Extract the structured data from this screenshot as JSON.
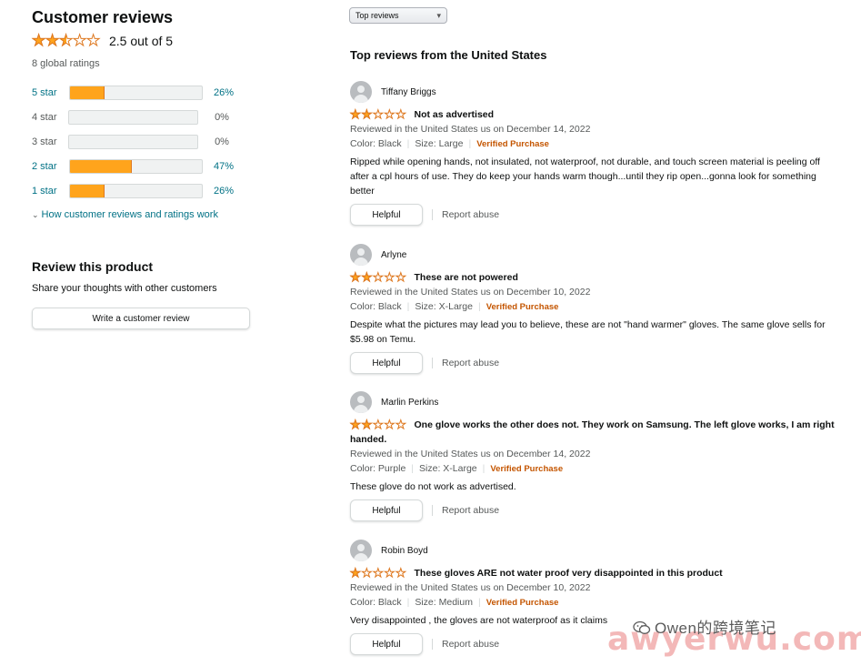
{
  "summary": {
    "title": "Customer reviews",
    "average_rating": 2.5,
    "average_text": "2.5 out of 5",
    "global_ratings": "8 global ratings",
    "histogram": [
      {
        "label": "5 star",
        "percent": 26,
        "percent_text": "26%"
      },
      {
        "label": "4 star",
        "percent": 0,
        "percent_text": "0%"
      },
      {
        "label": "3 star",
        "percent": 0,
        "percent_text": "0%"
      },
      {
        "label": "2 star",
        "percent": 47,
        "percent_text": "47%"
      },
      {
        "label": "1 star",
        "percent": 26,
        "percent_text": "26%"
      }
    ],
    "how_link": "How customer reviews and ratings work"
  },
  "review_product": {
    "title": "Review this product",
    "subtitle": "Share your thoughts with other customers",
    "button": "Write a customer review"
  },
  "sort": {
    "selected": "Top reviews"
  },
  "reviews_heading": "Top reviews from the United States",
  "reviews": [
    {
      "name": "Tiffany Briggs",
      "rating": 2,
      "title": "Not as advertised",
      "date": "Reviewed in the United States us on December 14, 2022",
      "color": "Color: Black",
      "size": "Size: Large",
      "verified": "Verified Purchase",
      "body": "Ripped while opening hands, not insulated, not waterproof, not durable, and touch screen material is peeling off after a cpl hours of use. They do keep your hands warm though...until they rip open...gonna look for something better",
      "helpful": "Helpful",
      "report": "Report abuse"
    },
    {
      "name": "Arlyne",
      "rating": 2,
      "title": "These are not powered",
      "date": "Reviewed in the United States us on December 10, 2022",
      "color": "Color: Black",
      "size": "Size: X-Large",
      "verified": "Verified Purchase",
      "body": "Despite what the pictures may lead you to believe, these are not \"hand warmer\" gloves. The same glove sells for $5.98 on Temu.",
      "helpful": "Helpful",
      "report": "Report abuse"
    },
    {
      "name": "Marlin Perkins",
      "rating": 2,
      "title": "One glove works the other does not. They work on Samsung. The left glove works, I am right handed.",
      "date": "Reviewed in the United States us on December 14, 2022",
      "color": "Color: Purple",
      "size": "Size: X-Large",
      "verified": "Verified Purchase",
      "body": "These glove do not work as advertised.",
      "helpful": "Helpful",
      "report": "Report abuse"
    },
    {
      "name": "Robin Boyd",
      "rating": 1,
      "title": "These gloves ARE not water proof very disappointed in this product",
      "date": "Reviewed in the United States us on December 10, 2022",
      "color": "Color: Black",
      "size": "Size: Medium",
      "verified": "Verified Purchase",
      "body": "Very disappointed , the gloves are not waterproof as it claims",
      "helpful": "Helpful",
      "report": "Report abuse"
    }
  ],
  "watermark": {
    "wechat_text": "Owen的跨境笔记",
    "url_text": "awyerwu.com"
  },
  "colors": {
    "star_fill": "#ffa41c",
    "star_outline": "#de7921",
    "link": "#007185",
    "verified": "#c45500"
  }
}
